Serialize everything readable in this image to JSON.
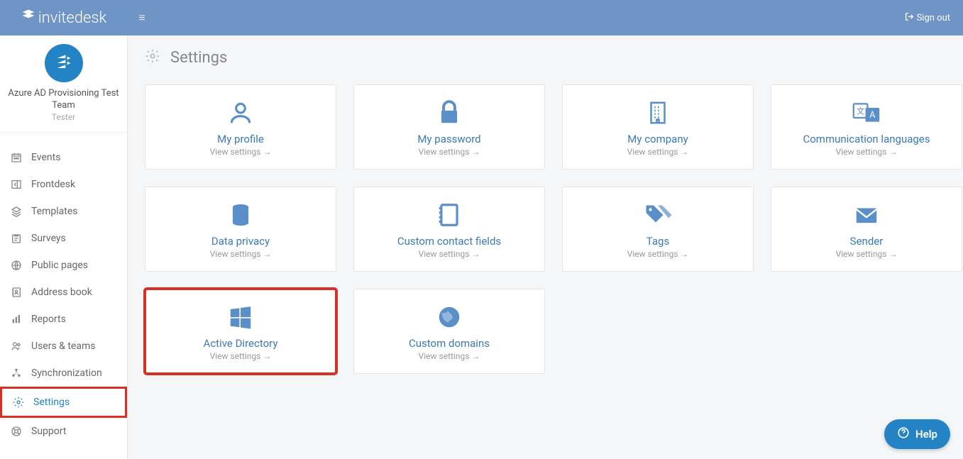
{
  "brand": "invitedesk",
  "sign_out_label": "Sign out",
  "profile": {
    "team": "Azure AD Provisioning Test Team",
    "role": "Tester"
  },
  "nav": [
    {
      "label": "Events"
    },
    {
      "label": "Frontdesk"
    },
    {
      "label": "Templates"
    },
    {
      "label": "Surveys"
    },
    {
      "label": "Public pages"
    },
    {
      "label": "Address book"
    },
    {
      "label": "Reports"
    },
    {
      "label": "Users & teams"
    },
    {
      "label": "Synchronization"
    },
    {
      "label": "Settings"
    },
    {
      "label": "Support"
    }
  ],
  "page_title": "Settings",
  "view_settings_label": "View settings →",
  "cards": [
    {
      "title": "My profile"
    },
    {
      "title": "My password"
    },
    {
      "title": "My company"
    },
    {
      "title": "Communication languages"
    },
    {
      "title": "Data privacy"
    },
    {
      "title": "Custom contact fields"
    },
    {
      "title": "Tags"
    },
    {
      "title": "Sender"
    },
    {
      "title": "Active Directory"
    },
    {
      "title": "Custom domains"
    }
  ],
  "help_label": "Help"
}
